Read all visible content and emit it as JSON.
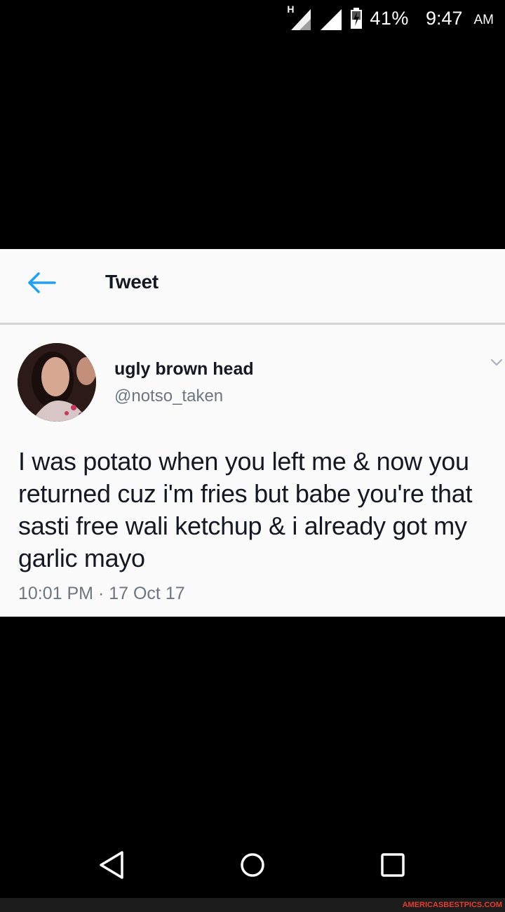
{
  "status_bar": {
    "network_type": "H",
    "signal_icon": "cell-signal-icon",
    "battery_icon": "battery-charging-icon",
    "battery_percent": "41%",
    "time": "9:47",
    "ampm": "AM"
  },
  "header": {
    "back_icon": "back-arrow-icon",
    "title": "Tweet"
  },
  "tweet": {
    "author": {
      "display_name": "ugly brown head",
      "handle": "@notso_taken"
    },
    "text": "I was potato when you left me & now you returned cuz i'm fries but babe you're that sasti free wali ketchup & i already got my garlic mayo",
    "timestamp": "10:01 PM · 17 Oct 17"
  },
  "nav_bar": {
    "back": "nav-back-icon",
    "home": "nav-home-icon",
    "recents": "nav-recents-icon"
  },
  "watermark": "AMERICASBESTPICS.COM",
  "colors": {
    "accent": "#1DA1F2",
    "text": "#141823",
    "muted": "#6c7680",
    "background": "#000000"
  }
}
